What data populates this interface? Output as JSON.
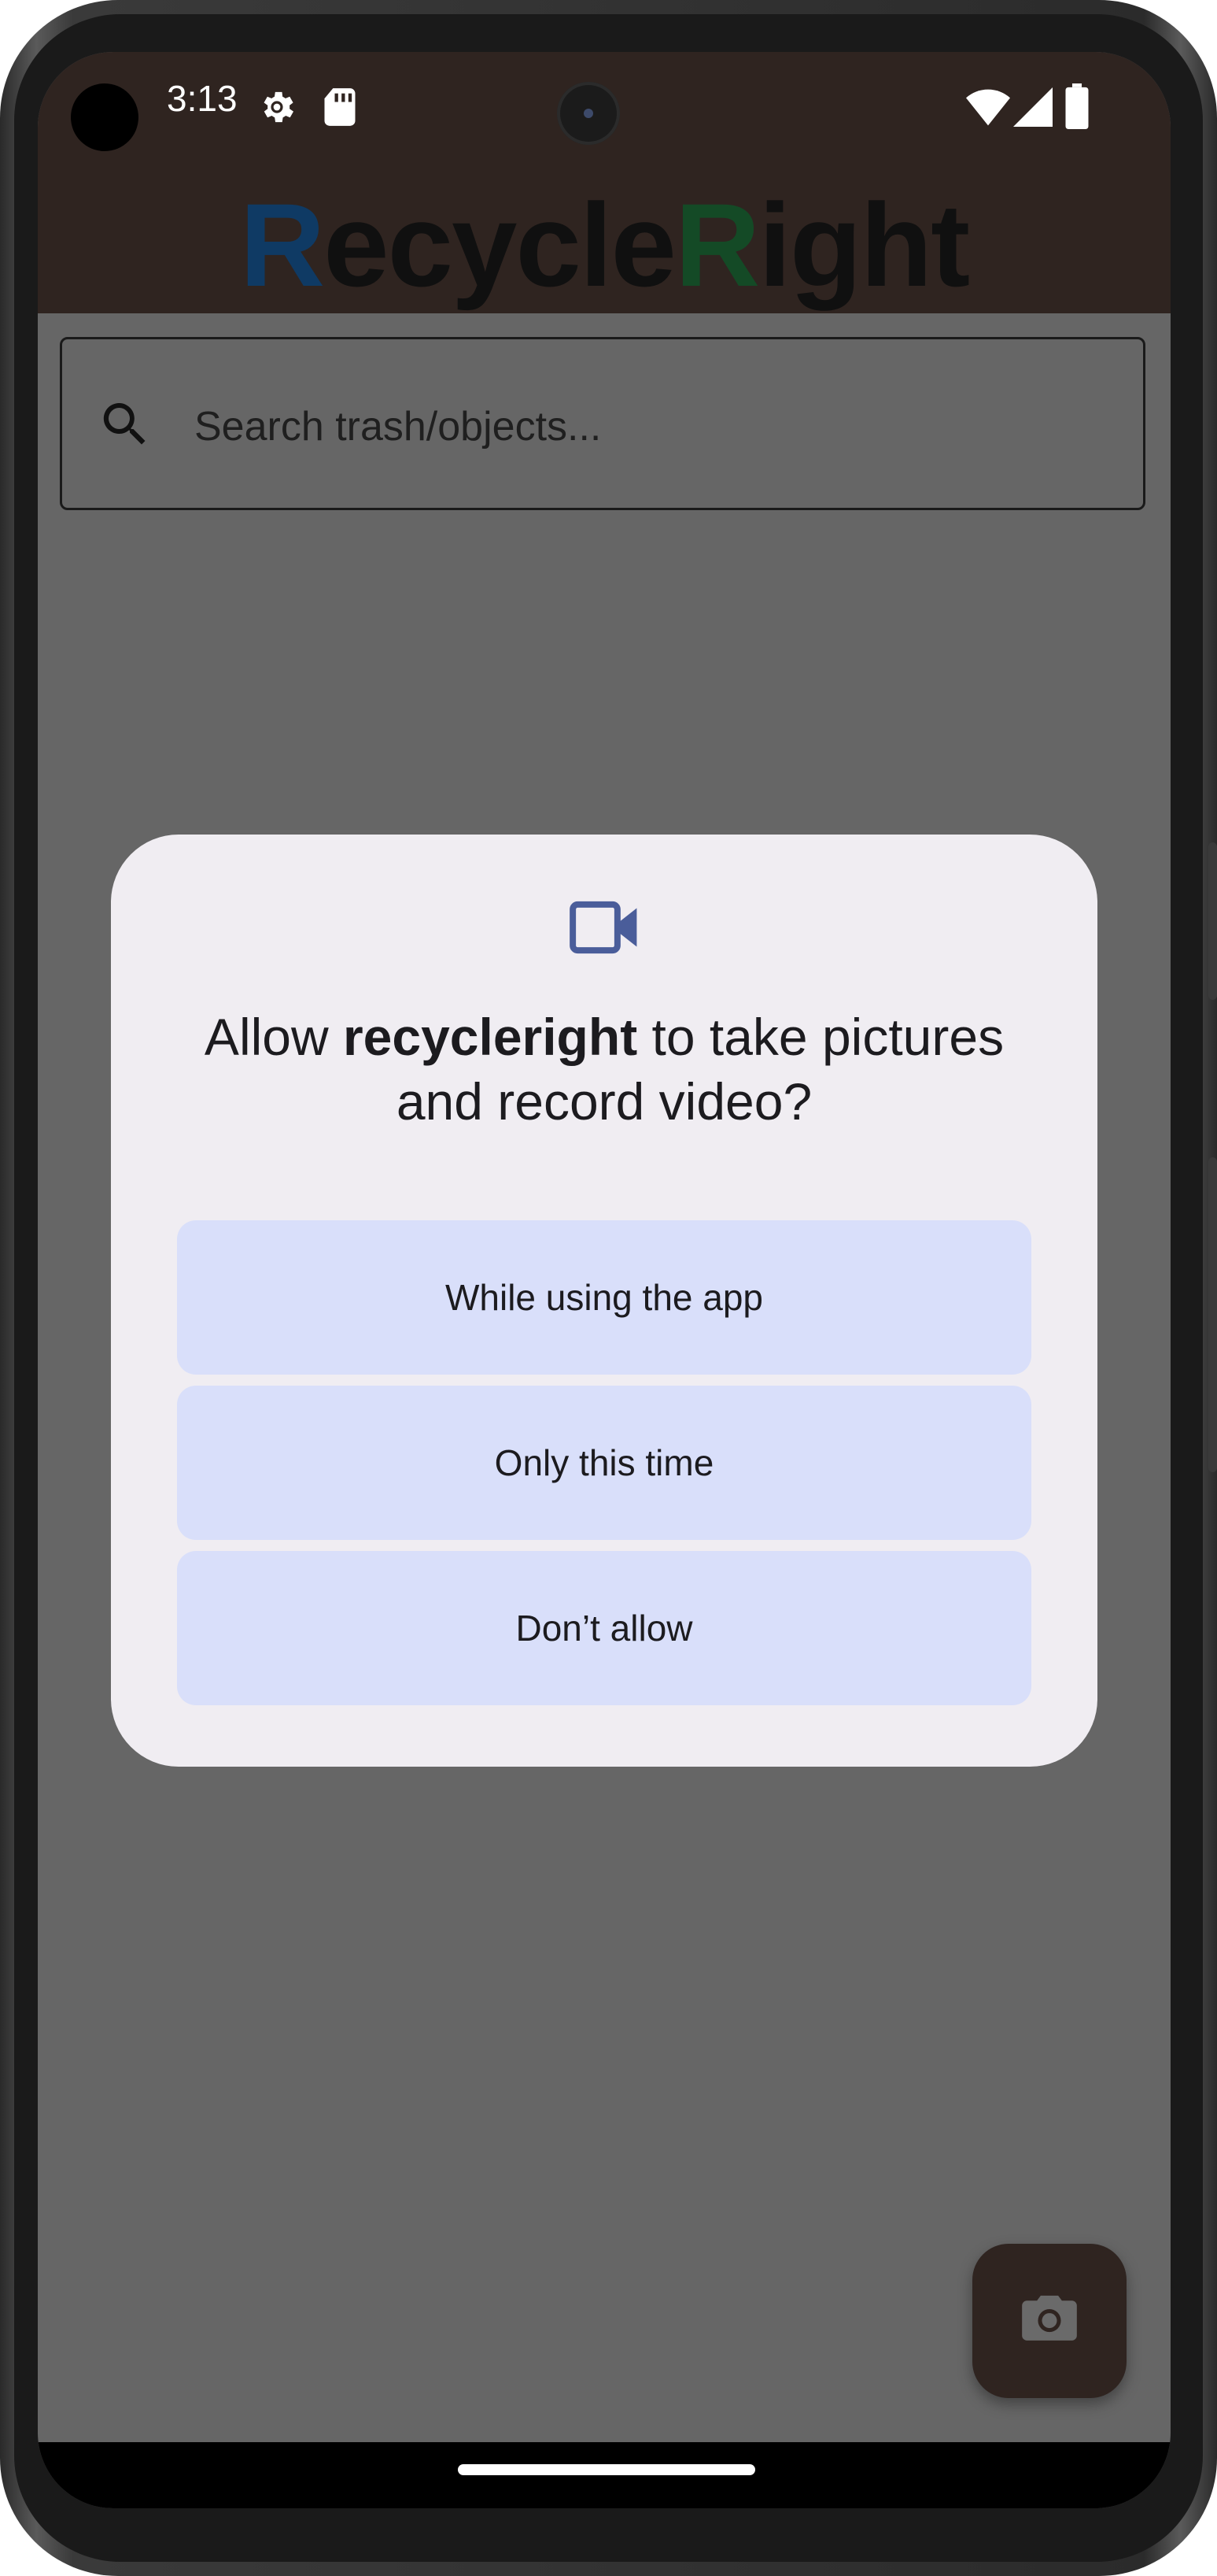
{
  "status_bar": {
    "time": "3:13",
    "icons": [
      "settings-gear-icon",
      "sd-card-icon",
      "wifi-icon",
      "signal-icon",
      "battery-icon"
    ]
  },
  "header": {
    "title_parts": [
      "R",
      "ecycle",
      "R",
      "ight"
    ],
    "colors": {
      "background": "#2f2420",
      "r1": "#0f3a64",
      "r2": "#144a26",
      "text": "#101010"
    }
  },
  "search": {
    "placeholder": "Search trash/objects...",
    "value": ""
  },
  "dialog": {
    "icon": "video-camera-icon",
    "title_prefix": "Allow ",
    "app_name": "recycleright",
    "title_suffix": " to take pictures and record video?",
    "buttons": [
      {
        "label": "While using the app"
      },
      {
        "label": "Only this time"
      },
      {
        "label": "Don’t allow"
      }
    ],
    "colors": {
      "background": "#f0edf2",
      "button": "#d9dffa",
      "accent_icon": "#4a5d9a"
    }
  },
  "fab": {
    "icon": "camera-icon"
  }
}
